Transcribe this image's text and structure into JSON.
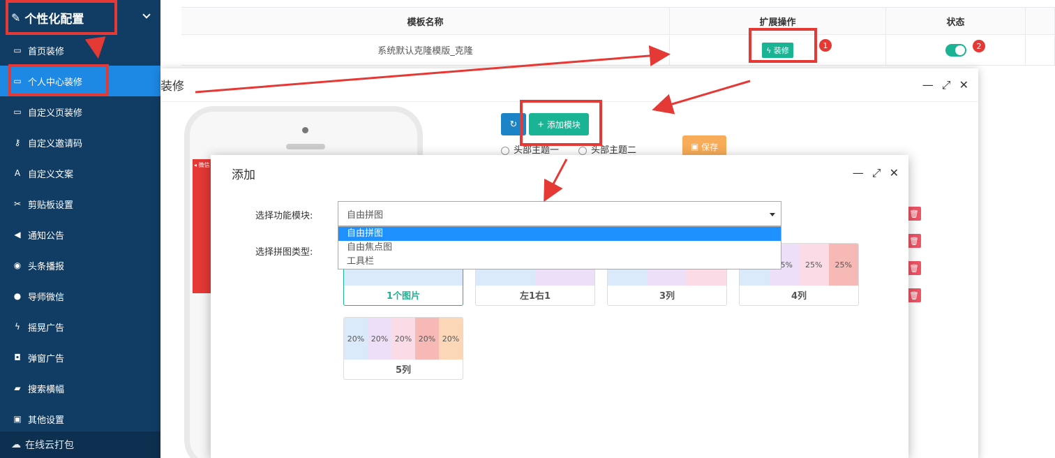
{
  "sidebar": {
    "header": "个性化配置",
    "items": [
      {
        "label": "首页装修",
        "icon": "window-icon"
      },
      {
        "label": "个人中心装修",
        "icon": "window-icon",
        "active": true
      },
      {
        "label": "自定义页装修",
        "icon": "window-icon"
      },
      {
        "label": "自定义邀请码",
        "icon": "key-icon"
      },
      {
        "label": "自定义文案",
        "icon": "font-icon"
      },
      {
        "label": "剪贴板设置",
        "icon": "scissors-icon"
      },
      {
        "label": "通知公告",
        "icon": "megaphone-icon"
      },
      {
        "label": "头条播报",
        "icon": "broadcast-icon"
      },
      {
        "label": "导师微信",
        "icon": "wechat-icon"
      },
      {
        "label": "摇晃广告",
        "icon": "bolt-icon"
      },
      {
        "label": "弹窗广告",
        "icon": "shield-icon"
      },
      {
        "label": "搜索横幅",
        "icon": "ad-icon"
      },
      {
        "label": "其他设置",
        "icon": "image-icon"
      }
    ],
    "footer": "在线云打包"
  },
  "table": {
    "headers": [
      "模板名称",
      "扩展操作",
      "状态"
    ],
    "row": {
      "name": "系统默认克隆模版_克隆",
      "action": "装修"
    }
  },
  "decorate_dialog": {
    "title": "装修",
    "add_module": "添加模块",
    "radio1": "头部主题一",
    "radio2": "头部主题二",
    "save": "保存",
    "phone_status": "◂ 微信"
  },
  "add_dialog": {
    "title": "添加",
    "label_module": "选择功能模块:",
    "label_type": "选择拼图类型:",
    "selected": "自由拼图",
    "options": [
      "自由拼图",
      "自由焦点图",
      "工具栏"
    ],
    "cards": [
      {
        "caption": "1个图片",
        "cells": [
          ""
        ]
      },
      {
        "caption": "左1右1",
        "cells": [
          "",
          ""
        ]
      },
      {
        "caption": "3列",
        "cells": [
          "",
          "",
          ""
        ]
      },
      {
        "caption": "4列",
        "cells": [
          "25%",
          "25%",
          "25%",
          "25%"
        ]
      },
      {
        "caption": "5列",
        "cells": [
          "20%",
          "20%",
          "20%",
          "20%",
          "20%"
        ]
      }
    ]
  },
  "annotations": {
    "badge1": "1",
    "badge2": "2"
  },
  "colors": {
    "sidebar": "#113d65",
    "active": "#1e88e5",
    "green": "#1ab394",
    "red": "#e53935",
    "orange": "#f8ac59"
  }
}
